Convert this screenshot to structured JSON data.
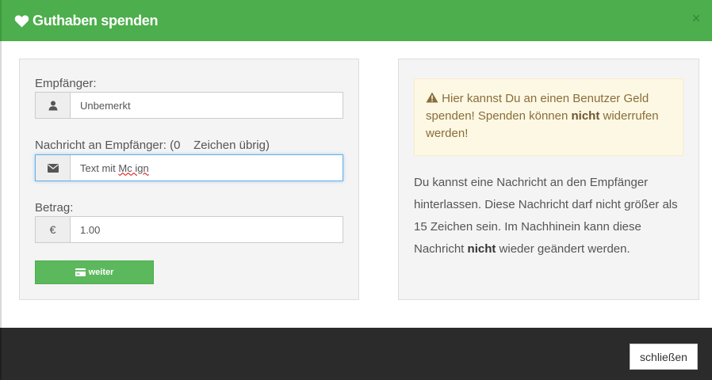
{
  "header": {
    "title": "Guthaben spenden",
    "close_glyph": "×",
    "accent_color": "#4cae4c"
  },
  "form": {
    "recipient": {
      "label": "Empfänger:",
      "icon": "user-icon",
      "value": "Unbemerkt"
    },
    "message": {
      "label_prefix": "Nachricht an Empfänger: (",
      "chars_left": "0",
      "label_suffix": "Zeichen übrig)",
      "icon": "envelope-icon",
      "value_before": "Text mit ",
      "value_misspelled": "Mc ign"
    },
    "amount": {
      "label": "Betrag:",
      "addon": "€",
      "value": "1.00"
    },
    "submit_label": "weiter"
  },
  "info": {
    "alert_part1": "Hier kannst Du an einen Benutzer Geld spenden! Spenden können ",
    "alert_bold": "nicht",
    "alert_part2": " widerrufen werden!",
    "text_part1": "Du kannst eine Nachricht an den Empfänger hinterlassen. Diese Nachricht darf nicht größer als 15 Zeichen sein. Im Nachhinein kann diese Nachricht ",
    "text_bold": "nicht",
    "text_part2": " wieder geändert werden."
  },
  "footer": {
    "close_label": "schließen"
  }
}
